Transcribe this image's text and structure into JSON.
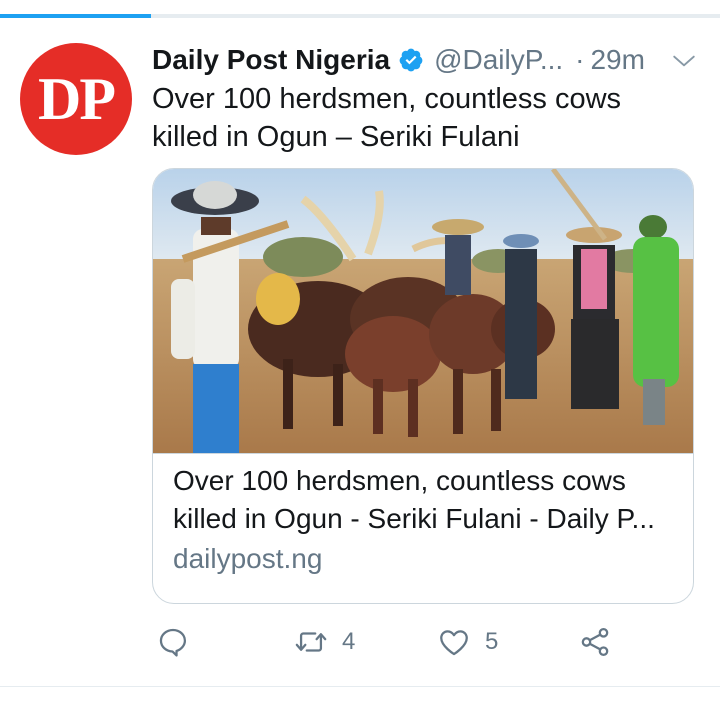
{
  "progress": {
    "fraction": 0.21,
    "color": "#1da1f2"
  },
  "tweet": {
    "avatar_text": "DP",
    "avatar_color": "#e52d27",
    "display_name": "Daily Post Nigeria",
    "verified_icon": "verified-badge-icon",
    "handle": "@DailyP...",
    "separator": "·",
    "time": "29m",
    "menu_icon": "chevron-down-icon",
    "text_line1": "Over 100 herdsmen, countless cows",
    "text_line2": "killed in Ogun – Seriki Fulani"
  },
  "card": {
    "title_line1": "Over 100 herdsmen, countless cows",
    "title_line2": "killed in Ogun - Seriki Fulani - Daily P...",
    "domain": "dailypost.ng"
  },
  "actions": {
    "reply_icon": "reply-icon",
    "retweet_icon": "retweet-icon",
    "retweet_count": "4",
    "like_icon": "heart-icon",
    "like_count": "5",
    "share_icon": "share-icon"
  },
  "colors": {
    "accent": "#1da1f2",
    "text": "#14171a",
    "secondary": "#657786",
    "border": "#ccd6dd"
  }
}
